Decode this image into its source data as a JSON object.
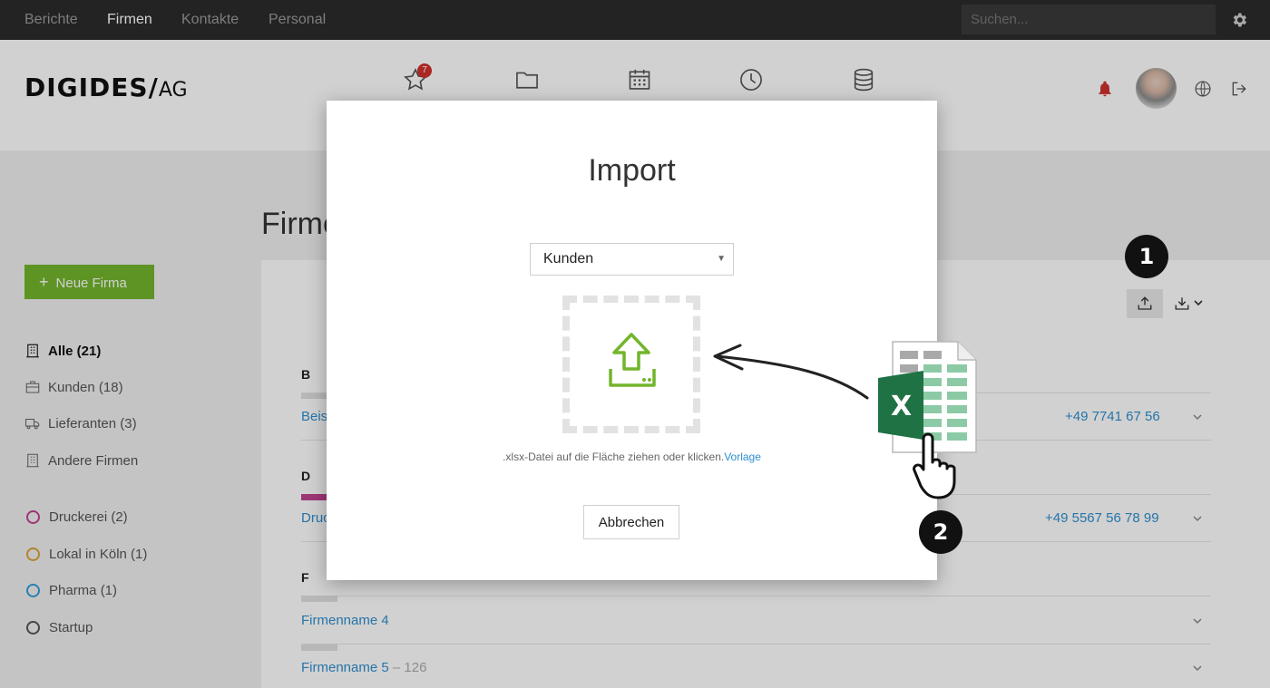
{
  "topbar": {
    "nav": [
      {
        "label": "Berichte",
        "active": false
      },
      {
        "label": "Firmen",
        "active": true
      },
      {
        "label": "Kontakte",
        "active": false
      },
      {
        "label": "Personal",
        "active": false
      }
    ],
    "search_placeholder": "Suchen...",
    "settings_icon": "gear-icon"
  },
  "header": {
    "logo_main": "DIGIDES/",
    "logo_suffix": "AG",
    "icons": [
      "star-icon",
      "folder-icon",
      "calendar-icon",
      "clock-icon",
      "database-icon"
    ],
    "favorites_count": "7",
    "right_icons": [
      "bell-icon",
      "avatar",
      "globe-icon",
      "logout-icon"
    ],
    "bell_color": "#d0312d"
  },
  "page": {
    "title": "Firmen",
    "new_button": "Neue Firma",
    "accent": "#72b52c"
  },
  "sidebar": {
    "items": [
      {
        "label": "Alle (21)",
        "icon": "building-icon",
        "active": true
      },
      {
        "label": "Kunden (18)",
        "icon": "briefcase-icon",
        "active": false
      },
      {
        "label": "Lieferanten (3)",
        "icon": "truck-icon",
        "active": false
      },
      {
        "label": "Andere Firmen",
        "icon": "building-icon",
        "active": false
      }
    ],
    "tags": [
      {
        "label": "Druckerei (2)",
        "color": "#c0438f"
      },
      {
        "label": "Lokal in Köln (1)",
        "color": "#d8a237"
      },
      {
        "label": "Pharma (1)",
        "color": "#2f9fd8"
      },
      {
        "label": "Startup",
        "color": "#555555"
      }
    ]
  },
  "list": {
    "sections": [
      {
        "letter": "B",
        "rows": [
          {
            "name": "Beis",
            "phone": "+49 7741 67 56"
          }
        ]
      },
      {
        "letter": "D",
        "rows": [
          {
            "name": "Druc",
            "phone": "+49 5567 56 78 99"
          }
        ]
      },
      {
        "letter": "F",
        "rows": [
          {
            "name": "Firmenname 4",
            "phone": ""
          },
          {
            "name": "Firmenname 5",
            "suffix": "– 126",
            "phone": ""
          }
        ]
      }
    ],
    "upload_icon": "upload-icon",
    "download_icon": "download-icon"
  },
  "modal": {
    "title": "Import",
    "select_value": "Kunden",
    "hint": ".xlsx-Datei auf die Fläche ziehen oder klicken.",
    "hint_link": "Vorlage",
    "cancel": "Abbrechen",
    "upload_color": "#72b52c"
  },
  "annotations": {
    "step1": "1",
    "step2": "2",
    "excel_letter": "X",
    "excel_color": "#1f7244"
  }
}
